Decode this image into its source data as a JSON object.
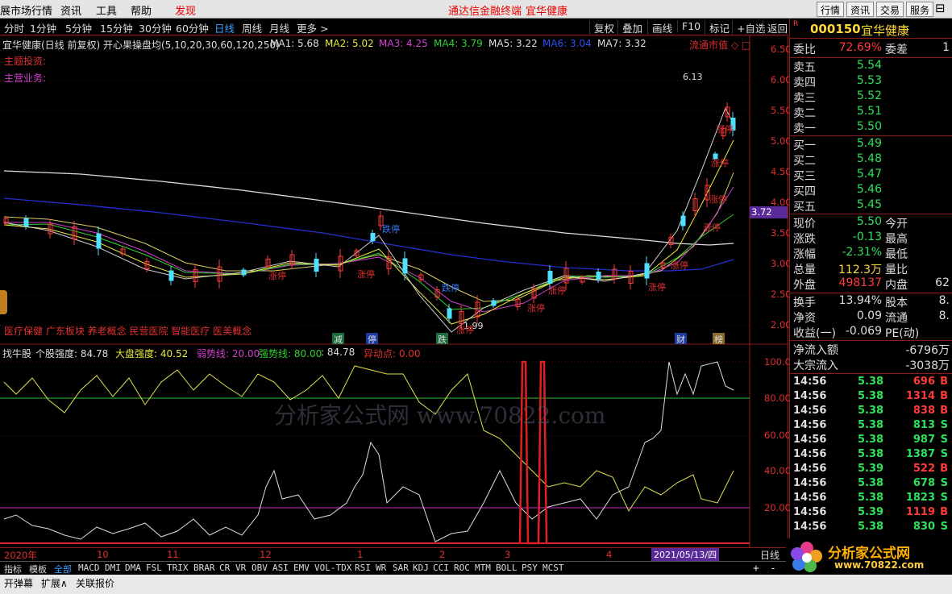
{
  "topbar": {
    "menu1": "展市场行情",
    "menu2": "资讯",
    "menu3": "工具",
    "menu4": "帮助",
    "menu5": "发现",
    "center1": "通达信金融终端",
    "center2": "宜华健康",
    "b1": "行情",
    "b2": "资讯",
    "b3": "交易",
    "b4": "服务"
  },
  "periods": [
    "分时",
    "1分钟",
    "5分钟",
    "15分钟",
    "30分钟",
    "60分钟",
    "日线",
    "周线",
    "月线",
    "更多 >"
  ],
  "toolbar_right": [
    "复权",
    "叠加",
    "画线",
    "F10",
    "标记",
    "+自选",
    "返回"
  ],
  "ma_line": {
    "name": "宜华健康(日线 前复权) 开心果操盘均(5,10,20,30,60,120,250)",
    "ma1": "MA1: 5.68",
    "ma2": "MA2: 5.02",
    "ma3": "MA3: 4.25",
    "ma4": "MA4: 3.79",
    "ma5": "MA5: 3.22",
    "ma6": "MA6: 3.04",
    "ma7": "MA7: 3.32"
  },
  "flow": "流通市值 ◇ □",
  "topic1": "主题投资:",
  "topic2": "主营业务:",
  "concepts": "医疗保健 广东板块 养老概念 民营医院 智能医疗 医美概念",
  "price_axis": [
    "6.50",
    "6.00",
    "5.50",
    "5.00",
    "4.50",
    "4.00",
    "3.50",
    "3.00",
    "2.50",
    "2.00"
  ],
  "current_label": "3.72",
  "high_label": "6.13",
  "low_label": "1.99",
  "events": [
    "减",
    "停",
    "跌",
    "财",
    "榜"
  ],
  "limit_tags": {
    "zt": "涨停",
    "dt": "跌停"
  },
  "indicator": {
    "name": "找牛股",
    "strength": "个股强度: 84.78",
    "market": "大盘强度: 40.52",
    "weak": "弱势线: 20.00",
    "strong": "强势线: 80.00",
    "val": ": 84.78",
    "abn": "异动点: 0.00"
  },
  "ind_axis": [
    "100.0",
    "80.00",
    "60.00",
    "40.00",
    "20.00"
  ],
  "date_axis": [
    "2020年",
    "10",
    "11",
    "12",
    "1",
    "2",
    "3",
    "4"
  ],
  "date_cur": "2021/05/13/四",
  "period_label": "日线",
  "tabs": [
    "指标",
    "模板",
    "全部",
    "MACD",
    "DMI",
    "DMA",
    "FSL",
    "TRIX",
    "BRAR",
    "CR",
    "VR",
    "OBV",
    "ASI",
    "EMV",
    "VOL-TDX",
    "RSI",
    "WR",
    "SAR",
    "KDJ",
    "CCI",
    "ROC",
    "MTM",
    "BOLL",
    "PSY",
    "MCST"
  ],
  "bottom": [
    "开弹幕",
    "扩展∧",
    "关联报价"
  ],
  "watermark": "分析家公式网 www.70822.com",
  "logo_text": "分析家公式网",
  "logo_url": "www.70822.com",
  "stock": {
    "flag": "R",
    "code": "000150",
    "name": "宜华健康"
  },
  "wb": {
    "k1": "委比",
    "v1": "72.69%",
    "k2": "委差",
    "v2": "1"
  },
  "asks": [
    {
      "k": "卖五",
      "v": "5.54"
    },
    {
      "k": "卖四",
      "v": "5.53"
    },
    {
      "k": "卖三",
      "v": "5.52"
    },
    {
      "k": "卖二",
      "v": "5.51"
    },
    {
      "k": "卖一",
      "v": "5.50"
    }
  ],
  "bids": [
    {
      "k": "买一",
      "v": "5.49"
    },
    {
      "k": "买二",
      "v": "5.48"
    },
    {
      "k": "买三",
      "v": "5.47"
    },
    {
      "k": "买四",
      "v": "5.46"
    },
    {
      "k": "买五",
      "v": "5.45"
    }
  ],
  "quote": [
    {
      "k": "现价",
      "v": "5.50",
      "k2": "今开"
    },
    {
      "k": "涨跌",
      "v": "-0.13",
      "k2": "最高"
    },
    {
      "k": "涨幅",
      "v": "-2.31%",
      "k2": "最低"
    },
    {
      "k": "总量",
      "v": "112.3万",
      "k2": "量比"
    },
    {
      "k": "外盘",
      "v": "498137",
      "k2": "内盘",
      "v2": "62"
    }
  ],
  "quote2": [
    {
      "k": "换手",
      "v": "13.94%",
      "k2": "股本",
      "v2": "8."
    },
    {
      "k": "净资",
      "v": "0.09",
      "k2": "流通",
      "v2": "8."
    },
    {
      "k": "收益(一)",
      "v": "-0.069",
      "k2": "PE(动)"
    }
  ],
  "netflow": {
    "k1": "净流入额",
    "v1": "-6796万",
    "k2": "大宗流入",
    "v2": "-3038万"
  },
  "ticks": [
    {
      "t": "14:56",
      "p": "5.38",
      "q": "696",
      "d": "B"
    },
    {
      "t": "14:56",
      "p": "5.38",
      "q": "1314",
      "d": "B"
    },
    {
      "t": "14:56",
      "p": "5.38",
      "q": "838",
      "d": "B"
    },
    {
      "t": "14:56",
      "p": "5.38",
      "q": "813",
      "d": "S"
    },
    {
      "t": "14:56",
      "p": "5.38",
      "q": "987",
      "d": "S"
    },
    {
      "t": "14:56",
      "p": "5.38",
      "q": "1387",
      "d": "S"
    },
    {
      "t": "14:56",
      "p": "5.39",
      "q": "522",
      "d": "B"
    },
    {
      "t": "14:56",
      "p": "5.38",
      "q": "678",
      "d": "S"
    },
    {
      "t": "14:56",
      "p": "5.38",
      "q": "1823",
      "d": "S"
    },
    {
      "t": "14:56",
      "p": "5.39",
      "q": "1119",
      "d": "B"
    },
    {
      "t": "14:56",
      "p": "5.38",
      "q": "830",
      "d": "S"
    }
  ]
}
